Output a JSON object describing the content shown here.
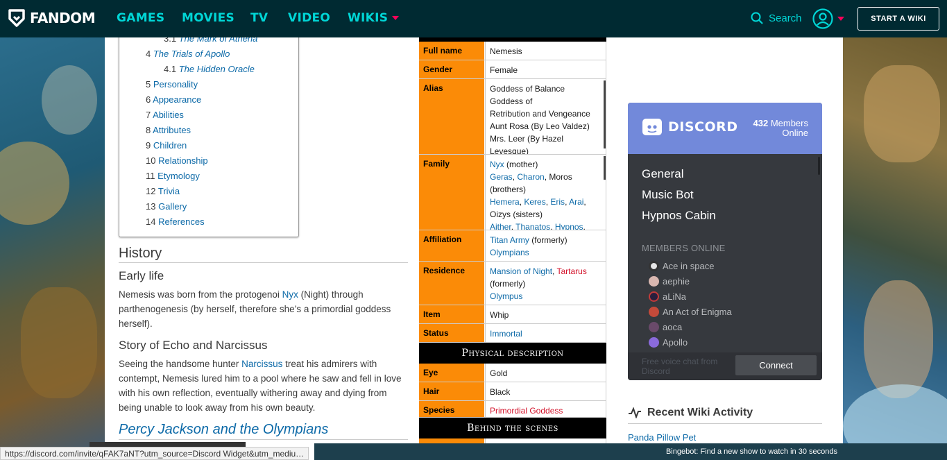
{
  "nav": {
    "logo": "FANDOM",
    "links": [
      "GAMES",
      "MOVIES",
      "TV",
      "VIDEO",
      "WIKIS"
    ],
    "search_label": "Search",
    "start_wiki": "START A WIKI"
  },
  "toc": {
    "items": [
      {
        "num": "3.1",
        "label": "The Mark of Athena"
      },
      {
        "num": "4",
        "label": "The Trials of Apollo"
      },
      {
        "num": "4.1",
        "label": "The Hidden Oracle"
      },
      {
        "num": "5",
        "label": "Personality"
      },
      {
        "num": "6",
        "label": "Appearance"
      },
      {
        "num": "7",
        "label": "Abilities"
      },
      {
        "num": "8",
        "label": "Attributes"
      },
      {
        "num": "9",
        "label": "Children"
      },
      {
        "num": "10",
        "label": "Relationship"
      },
      {
        "num": "11",
        "label": "Etymology"
      },
      {
        "num": "12",
        "label": "Trivia"
      },
      {
        "num": "13",
        "label": "Gallery"
      },
      {
        "num": "14",
        "label": "References"
      }
    ]
  },
  "article": {
    "history": "History",
    "early_life": "Early life",
    "early_p1": "Nemesis was born from the protogenoi ",
    "early_link": "Nyx",
    "early_p2": "  (Night) through parthenogenesis (by herself, therefore she’s a primordial goddess herself).",
    "echo_title": "Story of Echo and Narcissus",
    "echo_p1": "Seeing the handsome hunter ",
    "echo_link": "Narcissus",
    "echo_p2": " treat his admirers with contempt, Nemesis lured him to a pool where he saw and fell in love with his own reflection, eventually withering away and dying from being unable to look away from his own beauty.",
    "pjo_title": "Percy Jackson and the Olympians"
  },
  "infobox": {
    "full_name": {
      "label": "Full name",
      "value": "Nemesis"
    },
    "gender": {
      "label": "Gender",
      "value": "Female"
    },
    "alias": {
      "label": "Alias",
      "lines": [
        "Goddess of Balance",
        "Goddess of",
        "Retribution and Vengeance",
        "Aunt Rosa (By Leo Valdez)",
        "Mrs. Leer (By Hazel",
        "Levesque)"
      ]
    },
    "family": {
      "label": "Family",
      "nyx": "Nyx",
      "mother": " (mother)",
      "geras": "Geras",
      "charon": "Charon",
      "moros": ", Moros",
      "brothers": "(brothers)",
      "hemera": "Hemera",
      "keres": "Keres",
      "eris": "Eris",
      "arai": "Arai",
      "oizys": "Oizys (sisters)",
      "aither": "Aither",
      "thanatos": "Thanatos",
      "hypnos": "Hypnos"
    },
    "affiliation": {
      "label": "Affiliation",
      "titan": "Titan Army",
      "formerly": " (formerly)",
      "olympians": "Olympians"
    },
    "residence": {
      "label": "Residence",
      "mansion": "Mansion of Night",
      "tartarus": "Tartarus",
      "formerly": "(formerly)",
      "olympus": "Olympus"
    },
    "item": {
      "label": "Item",
      "value": "Whip"
    },
    "status": {
      "label": "Status",
      "value": "Immortal"
    },
    "physical": "Physical description",
    "eye": {
      "label": "Eye",
      "value": "Gold"
    },
    "hair": {
      "label": "Hair",
      "value": "Black"
    },
    "species": {
      "label": "Species",
      "value": "Primordial Goddess"
    },
    "behind": "Behind the scenes"
  },
  "discord": {
    "brand": "DISCORD",
    "members_count": "432",
    "members_word": "Members",
    "online_word": "Online",
    "channels": [
      "General",
      "Music Bot",
      "Hypnos Cabin"
    ],
    "members_label": "MEMBERS ONLINE",
    "members": [
      "Ace in space",
      "aephie",
      "aLiNa",
      "An Act of Enigma",
      "aoca",
      "Apollo"
    ],
    "foot_text": "Free voice chat from Discord",
    "connect": "Connect"
  },
  "recent": {
    "title": "Recent Wiki Activity",
    "item": "Panda Pillow Pet"
  },
  "status_bar": {
    "url": "https://discord.com/invite/qFAK7aNT?utm_source=Discord Widget&utm_mediu…",
    "bingebot": "Bingebot: Find a new show to watch in 30 seconds"
  },
  "colors": {
    "nav_bg": "#002a32",
    "nav_link": "#00d6d6",
    "accent": "#fa005a",
    "infobox_label": "#fb8b07",
    "discord_blurple": "#7289da"
  }
}
